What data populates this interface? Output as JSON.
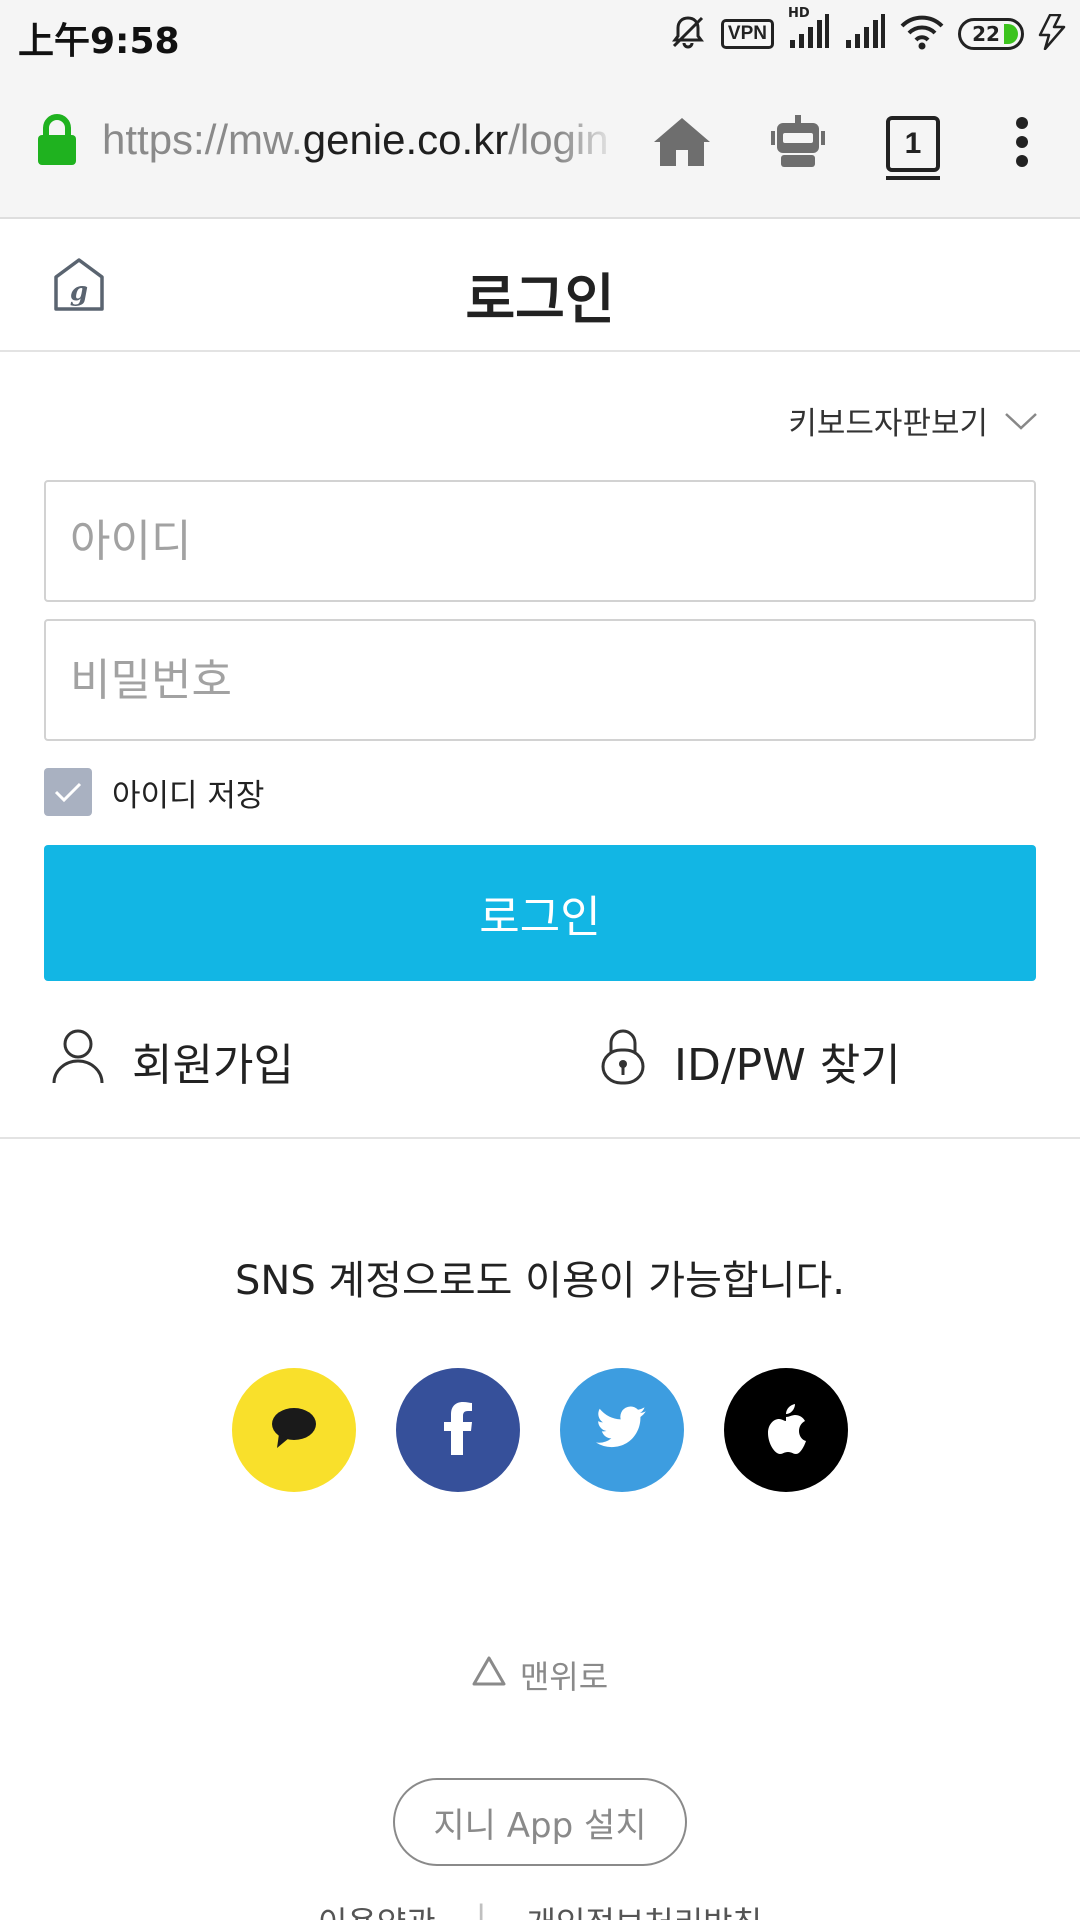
{
  "status_bar": {
    "time": "上午9:58",
    "vpn": "VPN",
    "network": "HD",
    "battery": "22",
    "icons": [
      "mute-icon",
      "vpn-icon",
      "signal-hd-icon",
      "signal-icon",
      "wifi-icon",
      "battery-icon",
      "charging-icon"
    ]
  },
  "browser": {
    "url_scheme": "https://mw.",
    "url_host": "genie.co.kr",
    "url_path": "/login",
    "tab_count": "1",
    "icons": [
      "lock-icon",
      "home-icon",
      "robot-icon",
      "tab-switcher-icon",
      "more-vert-icon"
    ],
    "lock_color": "#1fb21f"
  },
  "header": {
    "title": "로그인",
    "logo": "g"
  },
  "form": {
    "keyboard_toggle": "키보드자판보기",
    "id_placeholder": "아이디",
    "pw_placeholder": "비밀번호",
    "save_id_label": "아이디 저장",
    "save_id_checked": true,
    "login_button": "로그인",
    "login_color": "#12b6e4"
  },
  "links": {
    "signup": "회원가입",
    "find": "ID/PW 찾기"
  },
  "sns": {
    "text": "SNS 계정으로도 이용이 가능합니다.",
    "buttons": [
      {
        "name": "kakao",
        "color": "#f9e02b"
      },
      {
        "name": "facebook",
        "color": "#36509a"
      },
      {
        "name": "twitter",
        "color": "#3d9de0"
      },
      {
        "name": "apple",
        "color": "#000000"
      }
    ]
  },
  "footer": {
    "top_link": "맨위로",
    "app_install": "지니 App 설치",
    "terms": "이용약관",
    "privacy": "개인정보처리방침"
  }
}
